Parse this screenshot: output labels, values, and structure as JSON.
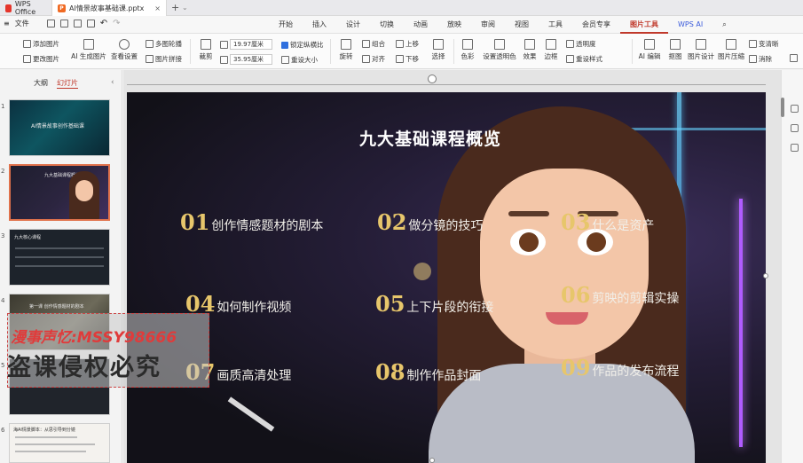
{
  "titlebar": {
    "app_name": "WPS Office",
    "doc_tab": "AI情景故事基础课.pptx",
    "close_glyph": "×",
    "new_tab_glyph": "+",
    "tab_menu_glyph": "⌄"
  },
  "menubar": {
    "file_label": "文件",
    "items": [
      "开始",
      "插入",
      "设计",
      "切换",
      "动画",
      "放映",
      "审阅",
      "视图",
      "工具",
      "会员专享",
      "图片工具",
      "WPS AI"
    ],
    "active_item": "图片工具"
  },
  "ribbon": {
    "add_picture": "添加图片",
    "change_picture": "更改图片",
    "ai_generate": "AI 生成图片",
    "reset_style": "查看设置",
    "multi_carousel": "多图轮播",
    "picture_splice": "图片拼接",
    "crop": "裁剪",
    "width_value": "19.97厘米",
    "height_value": "35.95厘米",
    "lock_ratio": "锁定纵横比",
    "reset_size": "重设大小",
    "rotate": "旋转",
    "group": "组合",
    "align": "对齐",
    "bring_forward": "上移",
    "send_backward": "下移",
    "select": "选择",
    "color": "色彩",
    "set_transparent": "设置透明色",
    "effects": "效果",
    "border": "边框",
    "transparency": "透明度",
    "reset_style2": "重设样式",
    "ai_edit": "AI 编辑",
    "cutout": "抠图",
    "picture_design": "图片设计",
    "compress": "图片压缩",
    "sharpen": "变清晰",
    "erase": "消除",
    "extra": "更"
  },
  "left_panel": {
    "tab_outline": "大纲",
    "tab_slides": "幻灯片",
    "collapse_glyph": "‹",
    "slide_numbers": [
      "1",
      "2",
      "3",
      "4",
      "5",
      "6"
    ],
    "thumb1_title": "AI情景故事创作基础课",
    "thumb2_title": "九大基础课程概览",
    "thumb3_title": "九大核心课程",
    "thumb4_title": "第一课 创作情感题材的剧本",
    "thumb6_title": "海AI情景脚本：从思引导到分镜"
  },
  "slide": {
    "title": "九大基础课程概览",
    "courses": [
      {
        "num": "01",
        "text": "创作情感题材的剧本"
      },
      {
        "num": "02",
        "text": "做分镜的技巧"
      },
      {
        "num": "03",
        "text": "什么是资产"
      },
      {
        "num": "04",
        "text": "如何制作视频"
      },
      {
        "num": "05",
        "text": "上下片段的衔接"
      },
      {
        "num": "06",
        "text": "剪映的剪辑实操"
      },
      {
        "num": "07",
        "text": "画质高清处理"
      },
      {
        "num": "08",
        "text": "制作作品封面"
      },
      {
        "num": "09",
        "text": "作品的发布流程"
      }
    ]
  },
  "watermark": {
    "line1": "漫事声忆:MSSY98666",
    "line2": "盗课侵权必究"
  },
  "colors": {
    "accent": "#c0392b",
    "number_gold": "#e7c66b",
    "selected_thumb_border": "#e0724c"
  }
}
